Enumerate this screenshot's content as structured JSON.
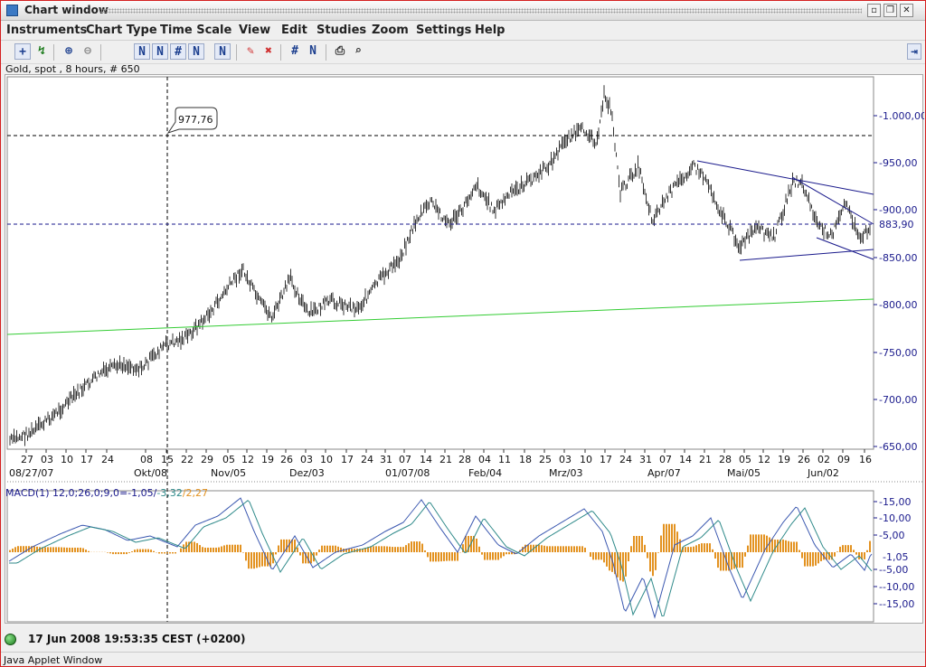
{
  "window": {
    "title": "Chart window"
  },
  "menu": [
    "Instruments",
    "Chart Type",
    "Time Scale",
    "View",
    "Edit",
    "Studies",
    "Zoom",
    "Settings",
    "Help"
  ],
  "toolbar": {
    "icons": [
      "crosshair-icon",
      "chart-select-icon",
      "zoom-in-icon",
      "zoom-out-icon",
      "bar-style-1-icon",
      "bar-style-2-icon",
      "bar-style-3-icon",
      "bar-style-4-icon",
      "bar-style-5-icon",
      "eraser-icon",
      "delete-icon",
      "grid-icon",
      "print-icon",
      "print-preview-icon"
    ],
    "right_icon": "pin-icon"
  },
  "instrument_line": "Gold, spot , 8 hours, # 650",
  "price_panel": {
    "cursor_label": "977,76",
    "last_price": "883,90",
    "y_ticks": [
      "1.000,00",
      "950,00",
      "900,00",
      "850,00",
      "800,00",
      "750,00",
      "700,00",
      "650,00"
    ],
    "x_ticks": [
      "27",
      "03",
      "10",
      "17",
      "24",
      "08",
      "15",
      "22",
      "29",
      "05",
      "12",
      "19",
      "26",
      "03",
      "10",
      "17",
      "24",
      "31",
      "07",
      "14",
      "21",
      "28",
      "04",
      "11",
      "18",
      "25",
      "03",
      "10",
      "17",
      "24",
      "31",
      "07",
      "14",
      "21",
      "28",
      "05",
      "12",
      "19",
      "26",
      "02",
      "09",
      "16"
    ],
    "month_labels": [
      "08/27/07",
      "Okt/08",
      "Nov/05",
      "Dez/03",
      "01/07/08",
      "Feb/04",
      "Mrz/03",
      "Apr/07",
      "Mai/05",
      "Jun/02"
    ]
  },
  "macd_panel": {
    "label_prefix": "MACD(1) 12,0;26,0;9,0=",
    "macd_value": "-1,05",
    "signal_value": "-3,32",
    "hist_value": "2,27",
    "last_value": "-1,05",
    "y_ticks": [
      "15,00",
      "10,00",
      "5,00",
      "-5,00",
      "-10,00",
      "-15,00"
    ]
  },
  "footer": {
    "timestamp": "17 Jun 2008 19:53:35  CEST (+0200)"
  },
  "applet_label": "Java Applet Window",
  "colors": {
    "macd_line": "#3b58b0",
    "signal_line": "#2f8a8a",
    "histogram": "#e39220",
    "trendline_green": "#33cc33",
    "channel_lines": "#1a1a8c",
    "price_axis": "#1a1a8c"
  }
}
